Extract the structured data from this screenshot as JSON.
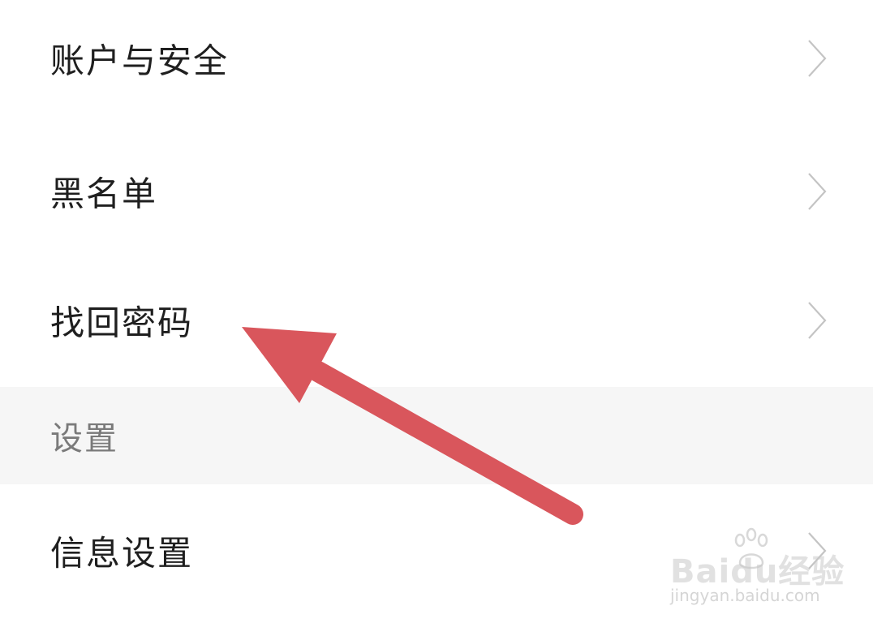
{
  "settings_list": {
    "items": [
      {
        "label": "账户与安全",
        "icon": "chevron-right-icon"
      },
      {
        "label": "黑名单",
        "icon": "chevron-right-icon"
      },
      {
        "label": "找回密码",
        "icon": "chevron-right-icon"
      }
    ],
    "section_header": "设置",
    "section_items": [
      {
        "label": "信息设置",
        "icon": "chevron-right-icon"
      }
    ]
  },
  "annotation": {
    "arrow_color": "#d9565c",
    "points_to": "找回密码"
  },
  "watermark": {
    "brand": "Baidu经验",
    "url": "jingyan.baidu.com"
  },
  "colors": {
    "background": "#ffffff",
    "section_background": "#f6f6f6",
    "text": "#1f1f1f",
    "section_text": "#7a7a7a",
    "chevron": "#c4c4c4"
  }
}
